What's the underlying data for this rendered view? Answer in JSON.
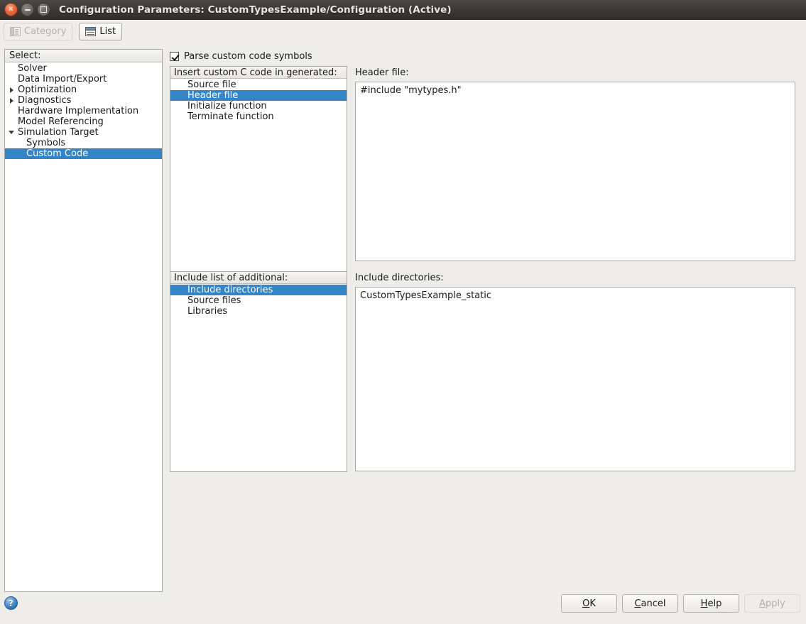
{
  "window": {
    "title": "Configuration Parameters: CustomTypesExample/Configuration (Active)",
    "close_glyph": "×",
    "controls": {
      "close_name": "close",
      "minimize_name": "minimize",
      "maximize_name": "maximize"
    }
  },
  "toolbar": {
    "category_label": "Category",
    "list_label": "List",
    "category_icon": "category-panes-icon",
    "list_icon": "list-table-icon"
  },
  "tree": {
    "header": "Select:",
    "items": [
      {
        "label": "Solver",
        "indent": 1,
        "toggle": "none",
        "selected": false
      },
      {
        "label": "Data Import/Export",
        "indent": 1,
        "toggle": "none",
        "selected": false
      },
      {
        "label": "Optimization",
        "indent": 0,
        "toggle": "collapsed",
        "selected": false
      },
      {
        "label": "Diagnostics",
        "indent": 0,
        "toggle": "collapsed",
        "selected": false
      },
      {
        "label": "Hardware Implementation",
        "indent": 1,
        "toggle": "none",
        "selected": false
      },
      {
        "label": "Model Referencing",
        "indent": 1,
        "toggle": "none",
        "selected": false
      },
      {
        "label": "Simulation Target",
        "indent": 0,
        "toggle": "expanded",
        "selected": false
      },
      {
        "label": "Symbols",
        "indent": 2,
        "toggle": "none",
        "selected": false
      },
      {
        "label": "Custom Code",
        "indent": 2,
        "toggle": "none",
        "selected": true
      }
    ]
  },
  "options": {
    "parse_custom_code_symbols": {
      "label": "Parse custom code symbols",
      "checked": true
    }
  },
  "insert_code_list": {
    "header": "Insert custom C code in generated:",
    "items": [
      {
        "label": "Source file",
        "selected": false
      },
      {
        "label": "Header file",
        "selected": true
      },
      {
        "label": "Initialize function",
        "selected": false
      },
      {
        "label": "Terminate function",
        "selected": false
      }
    ]
  },
  "include_list": {
    "header": "Include list of additional:",
    "items": [
      {
        "label": "Include directories",
        "selected": true
      },
      {
        "label": "Source files",
        "selected": false
      },
      {
        "label": "Libraries",
        "selected": false
      }
    ]
  },
  "header_file_field": {
    "label": "Header file:",
    "value": "#include \"mytypes.h\""
  },
  "include_dirs_field": {
    "label": "Include directories:",
    "value": "CustomTypesExample_static"
  },
  "footer": {
    "help_icon_glyph": "?",
    "buttons": [
      {
        "label": "OK",
        "mnemonic": "O",
        "rest": "K",
        "pre": "",
        "disabled": false,
        "name": "ok-button"
      },
      {
        "label": "Cancel",
        "mnemonic": "C",
        "rest": "ancel",
        "pre": "",
        "disabled": false,
        "name": "cancel-button"
      },
      {
        "label": "Help",
        "mnemonic": "H",
        "rest": "elp",
        "pre": "",
        "disabled": false,
        "name": "help-button"
      },
      {
        "label": "Apply",
        "mnemonic": "A",
        "rest": "pply",
        "pre": "",
        "disabled": true,
        "name": "apply-button"
      }
    ]
  },
  "colors": {
    "selection_blue": "#3584c6",
    "window_bg": "#efedea",
    "titlebar_dark": "#3c3936",
    "close_orange": "#e8683a"
  }
}
